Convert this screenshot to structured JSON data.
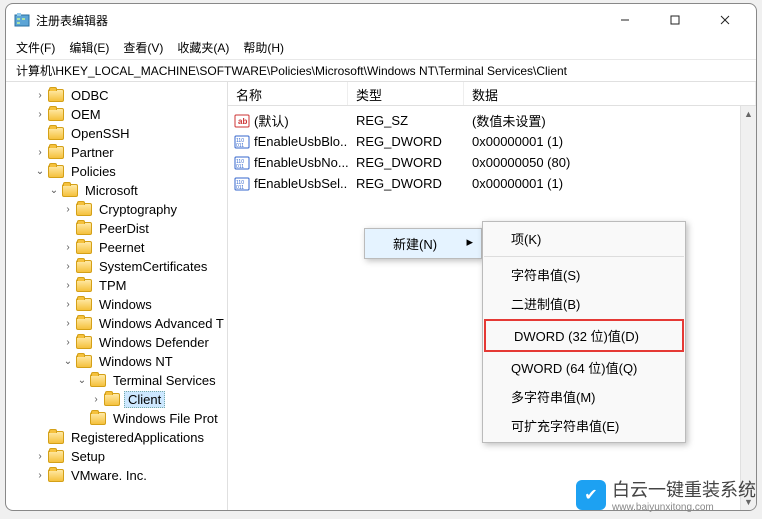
{
  "window": {
    "title": "注册表编辑器"
  },
  "menubar": [
    "文件(F)",
    "编辑(E)",
    "查看(V)",
    "收藏夹(A)",
    "帮助(H)"
  ],
  "address": "计算机\\HKEY_LOCAL_MACHINE\\SOFTWARE\\Policies\\Microsoft\\Windows NT\\Terminal Services\\Client",
  "tree": [
    {
      "label": "ODBC",
      "depth": 2,
      "arrow": ">"
    },
    {
      "label": "OEM",
      "depth": 2,
      "arrow": ">"
    },
    {
      "label": "OpenSSH",
      "depth": 2,
      "arrow": ""
    },
    {
      "label": "Partner",
      "depth": 2,
      "arrow": ">"
    },
    {
      "label": "Policies",
      "depth": 2,
      "arrow": "v"
    },
    {
      "label": "Microsoft",
      "depth": 3,
      "arrow": "v"
    },
    {
      "label": "Cryptography",
      "depth": 4,
      "arrow": ">"
    },
    {
      "label": "PeerDist",
      "depth": 4,
      "arrow": ""
    },
    {
      "label": "Peernet",
      "depth": 4,
      "arrow": ">"
    },
    {
      "label": "SystemCertificates",
      "depth": 4,
      "arrow": ">"
    },
    {
      "label": "TPM",
      "depth": 4,
      "arrow": ">"
    },
    {
      "label": "Windows",
      "depth": 4,
      "arrow": ">"
    },
    {
      "label": "Windows Advanced T",
      "depth": 4,
      "arrow": ">"
    },
    {
      "label": "Windows Defender",
      "depth": 4,
      "arrow": ">"
    },
    {
      "label": "Windows NT",
      "depth": 4,
      "arrow": "v"
    },
    {
      "label": "Terminal Services",
      "depth": 5,
      "arrow": "v"
    },
    {
      "label": "Client",
      "depth": 6,
      "arrow": ">",
      "selected": true
    },
    {
      "label": "Windows File Prot",
      "depth": 5,
      "arrow": ""
    },
    {
      "label": "RegisteredApplications",
      "depth": 2,
      "arrow": ""
    },
    {
      "label": "Setup",
      "depth": 2,
      "arrow": ">"
    },
    {
      "label": "VMware. Inc.",
      "depth": 2,
      "arrow": ">"
    }
  ],
  "list": {
    "headers": {
      "name": "名称",
      "type": "类型",
      "data": "数据"
    },
    "rows": [
      {
        "icon": "str",
        "name": "(默认)",
        "type": "REG_SZ",
        "data": "(数值未设置)"
      },
      {
        "icon": "bin",
        "name": "fEnableUsbBlo...",
        "type": "REG_DWORD",
        "data": "0x00000001 (1)"
      },
      {
        "icon": "bin",
        "name": "fEnableUsbNo...",
        "type": "REG_DWORD",
        "data": "0x00000050 (80)"
      },
      {
        "icon": "bin",
        "name": "fEnableUsbSel...",
        "type": "REG_DWORD",
        "data": "0x00000001 (1)"
      }
    ]
  },
  "context": {
    "new_label": "新建(N)",
    "submenu": [
      {
        "label": "项(K)"
      },
      {
        "sep": true
      },
      {
        "label": "字符串值(S)"
      },
      {
        "label": "二进制值(B)"
      },
      {
        "label": "DWORD (32 位)值(D)",
        "highlight": true
      },
      {
        "label": "QWORD (64 位)值(Q)"
      },
      {
        "label": "多字符串值(M)"
      },
      {
        "label": "可扩充字符串值(E)"
      }
    ]
  },
  "watermark": {
    "text": "白云一键重装系统",
    "url": "www.baiyunxitong.com"
  }
}
